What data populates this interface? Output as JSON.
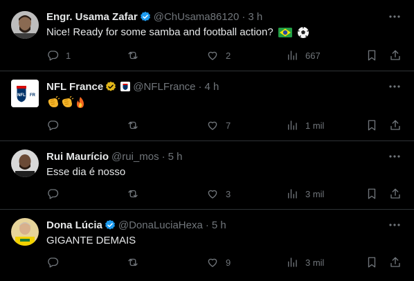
{
  "tweets": [
    {
      "name": "Engr. Usama Zafar",
      "handle": "@ChUsama86120",
      "time": "3 h",
      "verified": "blue",
      "text": "Nice! Ready for some samba and football action?",
      "emoji": [
        "brazil-flag",
        "soccer-ball"
      ],
      "replies": "1",
      "reposts": "",
      "likes": "2",
      "views": "667"
    },
    {
      "name": "NFL France",
      "handle": "@NFLFrance",
      "time": "4 h",
      "verified": "gold",
      "text": "",
      "emoji": [
        "clapping-hands",
        "clapping-hands",
        "fire"
      ],
      "replies": "",
      "reposts": "",
      "likes": "7",
      "views": "1 mil"
    },
    {
      "name": "Rui Maurício",
      "handle": "@rui_mos",
      "time": "5 h",
      "verified": "",
      "text": "Esse dia é nosso",
      "emoji": [],
      "replies": "",
      "reposts": "",
      "likes": "3",
      "views": "3 mil"
    },
    {
      "name": "Dona Lúcia",
      "handle": "@DonaLuciaHexa",
      "time": "5 h",
      "verified": "blue",
      "text": "GIGANTE DEMAIS",
      "emoji": [],
      "replies": "",
      "reposts": "",
      "likes": "9",
      "views": "3 mil"
    }
  ],
  "dot_separator": "·",
  "nfl_shield_text": "NFL",
  "colors": {
    "background": "#000000",
    "text_primary": "#e7e9ea",
    "text_secondary": "#71767b",
    "divider": "#2f3336",
    "verified_blue": "#1d9bf0",
    "verified_gold": "#e2b719"
  }
}
